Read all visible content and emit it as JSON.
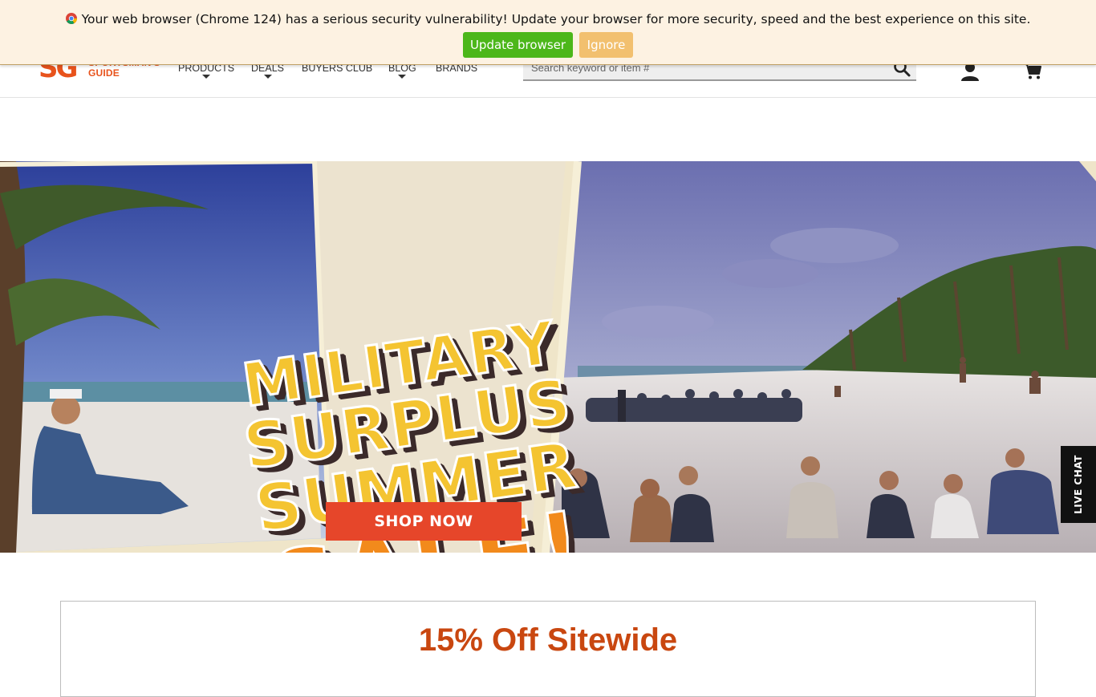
{
  "logo": {
    "mark": "SG",
    "line1": "SPORTSMAN'S",
    "line2": "GUIDE"
  },
  "nav": {
    "items": [
      {
        "label": "PRODUCTS",
        "has_dropdown": true
      },
      {
        "label": "DEALS",
        "has_dropdown": true
      },
      {
        "label": "BUYERS CLUB",
        "has_dropdown": false
      },
      {
        "label": "BLOG",
        "has_dropdown": true
      },
      {
        "label": "BRANDS",
        "has_dropdown": false
      }
    ]
  },
  "search": {
    "placeholder": "Search keyword or item #",
    "value": "",
    "icon": "search-icon"
  },
  "header_icons": {
    "account": "user-icon",
    "cart": "cart-icon"
  },
  "update_bar": {
    "message": "Your web browser (Chrome 124) has a serious security vulnerability! Update your browser for more security, speed and the best experience on this site.",
    "update_label": "Update browser",
    "ignore_label": "Ignore",
    "icon": "chrome-icon",
    "colors": {
      "background": "#fdf2e2",
      "update_button": "#4cb71a",
      "ignore_button": "#f2c06f"
    }
  },
  "hero": {
    "title_lines": [
      "MILITARY",
      "SURPLUS",
      "SUMMER",
      "SALE!"
    ],
    "cta_label": "SHOP NOW",
    "colors": {
      "cta": "#e6462a",
      "title_fill": "#f4c431"
    }
  },
  "live_chat": {
    "label": "LIVE CHAT"
  },
  "promo": {
    "heading": "15% Off Sitewide",
    "color": "#c94710"
  }
}
